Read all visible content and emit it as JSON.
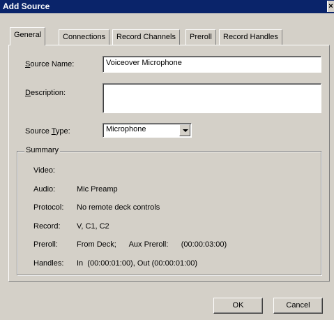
{
  "window": {
    "title": "Add Source",
    "close_glyph": "×"
  },
  "tabs": [
    {
      "label": "General",
      "active": true
    },
    {
      "label": "Connections",
      "active": false
    },
    {
      "label": "Record Channels",
      "active": false
    },
    {
      "label": "Preroll",
      "active": false
    },
    {
      "label": "Record Handles",
      "active": false
    }
  ],
  "general": {
    "source_name": {
      "accel": "S",
      "rest": "ource Name:",
      "value": "Voiceover Microphone"
    },
    "description": {
      "accel": "D",
      "rest": "escription:",
      "value": ""
    },
    "source_type": {
      "pre": "Source ",
      "accel": "T",
      "rest": "ype:",
      "value": "Microphone"
    }
  },
  "summary": {
    "title": "Summary",
    "rows": [
      {
        "key": "Video:",
        "value": ""
      },
      {
        "key": "Audio:",
        "value": "Mic Preamp"
      },
      {
        "key": "Protocol:",
        "value": "No remote deck controls"
      },
      {
        "key": "Record:",
        "value": "V, C1, C2"
      },
      {
        "key": "Preroll:",
        "value": "From Deck;      Aux Preroll:      (00:00:03:00)"
      },
      {
        "key": "Handles:",
        "value": "In  (00:00:01:00), Out (00:00:01:00)"
      }
    ]
  },
  "buttons": {
    "ok": "OK",
    "cancel": "Cancel"
  }
}
